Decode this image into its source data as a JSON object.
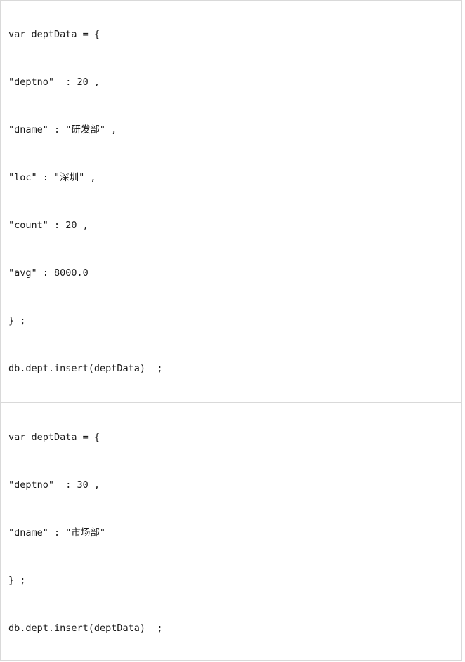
{
  "blocks": [
    {
      "lines": [
        "var deptData = {",
        "\"deptno\"  : 20 ,",
        "\"dname\" : \"研发部\" ,",
        "\"loc\" : \"深圳\" ,",
        "\"count\" : 20 ,",
        "\"avg\" : 8000.0",
        "} ;",
        "db.dept.insert(deptData)  ;"
      ]
    },
    {
      "lines": [
        "var deptData = {",
        "\"deptno\"  : 30 ,",
        "\"dname\" : \"市场部\"",
        "} ;",
        "db.dept.insert(deptData)  ;"
      ]
    }
  ]
}
